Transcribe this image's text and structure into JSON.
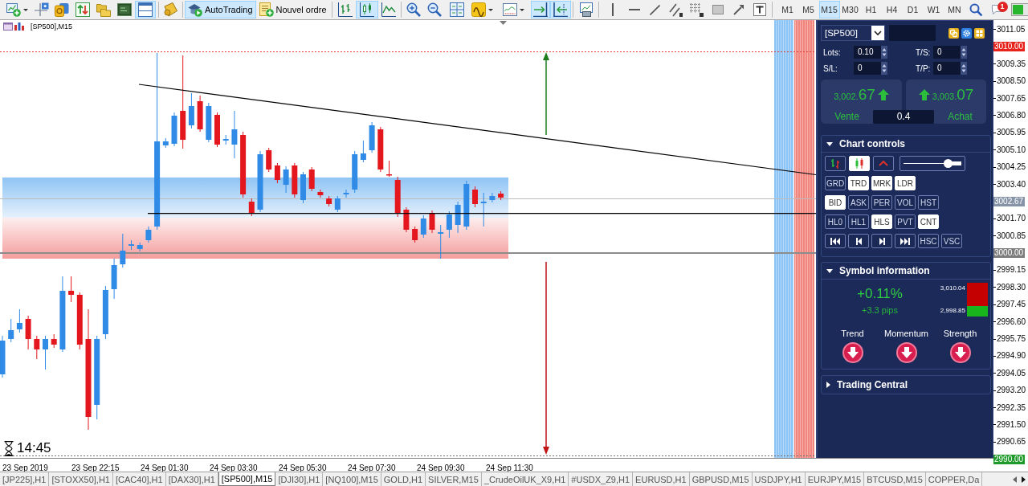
{
  "toolbar": {
    "buttons": [
      {
        "kind": "newchart",
        "pressed": false
      },
      {
        "kind": "crosshair",
        "pressed": false
      },
      {
        "kind": "coins",
        "pressed": false
      },
      {
        "kind": "navigator",
        "pressed": false
      },
      {
        "kind": "folders",
        "pressed": false
      },
      {
        "kind": "monitor",
        "pressed": false
      },
      {
        "kind": "panes",
        "pressed": true
      },
      {
        "kind": "separator"
      },
      {
        "kind": "scroll",
        "pressed": false
      },
      {
        "kind": "separator"
      },
      {
        "kind": "autotrading",
        "label": "AutoTrading",
        "pressed": true
      },
      {
        "kind": "neworder",
        "label": "Nouvel ordre",
        "pressed": false
      },
      {
        "kind": "separator"
      },
      {
        "kind": "barchart",
        "pressed": false
      },
      {
        "kind": "candles",
        "pressed": true
      },
      {
        "kind": "linechart",
        "pressed": false
      },
      {
        "kind": "separator"
      },
      {
        "kind": "zoomin",
        "pressed": false
      },
      {
        "kind": "zoomout",
        "pressed": false
      },
      {
        "kind": "tile",
        "pressed": false
      },
      {
        "kind": "indicators",
        "pressed": false
      },
      {
        "kind": "templates",
        "pressed": false
      },
      {
        "kind": "autoscroll",
        "pressed": true
      },
      {
        "kind": "shift",
        "pressed": true
      },
      {
        "kind": "separator"
      },
      {
        "kind": "properties",
        "pressed": false
      },
      {
        "kind": "separator"
      },
      {
        "kind": "vline",
        "pressed": false
      },
      {
        "kind": "hline",
        "pressed": false
      },
      {
        "kind": "trendline",
        "pressed": false
      },
      {
        "kind": "channel",
        "pressed": false
      },
      {
        "kind": "fibogrid",
        "pressed": false
      },
      {
        "kind": "rectangle",
        "pressed": false
      },
      {
        "kind": "arrow",
        "pressed": false
      },
      {
        "kind": "text",
        "pressed": false
      },
      {
        "kind": "separator"
      }
    ],
    "timeframes": [
      {
        "label": "M1",
        "selected": false
      },
      {
        "label": "M5",
        "selected": false
      },
      {
        "label": "M15",
        "selected": true
      },
      {
        "label": "M30",
        "selected": false
      },
      {
        "label": "H1",
        "selected": false
      },
      {
        "label": "H4",
        "selected": false
      },
      {
        "label": "D1",
        "selected": false
      },
      {
        "label": "W1",
        "selected": false
      },
      {
        "label": "MN",
        "selected": false
      }
    ],
    "status": [
      {
        "kind": "search"
      },
      {
        "kind": "chat",
        "badge": "1"
      },
      {
        "kind": "connection"
      }
    ]
  },
  "chart": {
    "title": "[SP500],M15",
    "timer": "14:45",
    "price_axis": [
      {
        "kind": "tick",
        "text": "3011.05"
      },
      {
        "kind": "tag",
        "text": "3010.00",
        "color": "#e8231b"
      },
      {
        "kind": "tick",
        "text": "3009.35"
      },
      {
        "kind": "tick",
        "text": "3008.50"
      },
      {
        "kind": "tick",
        "text": "3007.65"
      },
      {
        "kind": "tick",
        "text": "3006.80"
      },
      {
        "kind": "tick",
        "text": "3005.95"
      },
      {
        "kind": "tick",
        "text": "3005.10"
      },
      {
        "kind": "tick",
        "text": "3004.25"
      },
      {
        "kind": "tick",
        "text": "3003.40"
      },
      {
        "kind": "tag",
        "text": "3002.67",
        "color": "#8793a6"
      },
      {
        "kind": "tick",
        "text": "3001.70"
      },
      {
        "kind": "tick",
        "text": "3000.85"
      },
      {
        "kind": "tag",
        "text": "3000.00",
        "color": "#7d7d7d"
      },
      {
        "kind": "tick",
        "text": "2999.15"
      },
      {
        "kind": "tick",
        "text": "2998.30"
      },
      {
        "kind": "tick",
        "text": "2997.45"
      },
      {
        "kind": "tick",
        "text": "2996.60"
      },
      {
        "kind": "tick",
        "text": "2995.75"
      },
      {
        "kind": "tick",
        "text": "2994.90"
      },
      {
        "kind": "tick",
        "text": "2994.05"
      },
      {
        "kind": "tick",
        "text": "2993.20"
      },
      {
        "kind": "tick",
        "text": "2992.35"
      },
      {
        "kind": "tick",
        "text": "2991.50"
      },
      {
        "kind": "tick",
        "text": "2990.65"
      },
      {
        "kind": "tag",
        "text": "2990.00",
        "color": "#1f9a2b"
      }
    ],
    "time_axis": [
      "23 Sep 2019",
      "23 Sep 22:15",
      "24 Sep 01:30",
      "24 Sep 03:30",
      "24 Sep 05:30",
      "24 Sep 07:30",
      "24 Sep 09:30",
      "24 Sep 11:30"
    ]
  },
  "trade_panel": {
    "symbol": "[SP500]",
    "fields": [
      {
        "label": "Lots:",
        "value": "0.10"
      },
      {
        "label": "T/S:",
        "value": "0"
      },
      {
        "label": "S/L:",
        "value": "0"
      },
      {
        "label": "T/P:",
        "value": "0"
      }
    ],
    "sell": {
      "price_big_figure": "3,002.",
      "price_pips": "67",
      "rising": true,
      "label": "Vente"
    },
    "buy": {
      "price_big_figure": "3,003.",
      "price_pips": "07",
      "rising": true,
      "label": "Achat"
    },
    "spread": "0.4"
  },
  "chart_controls": {
    "title": "Chart controls",
    "expanded": true,
    "tools": [
      {
        "kind": "bars",
        "on": false
      },
      {
        "kind": "candles",
        "on": true
      },
      {
        "kind": "line",
        "on": false
      }
    ],
    "slider": {
      "level": 0.76
    },
    "buttons": [
      [
        {
          "label": "GRD",
          "on": false
        },
        {
          "label": "TRD",
          "on": true
        },
        {
          "label": "MRK",
          "on": true
        },
        {
          "label": "LDR",
          "on": true
        }
      ],
      [
        {
          "label": "BID",
          "on": true
        },
        {
          "label": "ASK",
          "on": false
        },
        {
          "label": "PER",
          "on": false
        },
        {
          "label": "VOL",
          "on": false
        },
        {
          "label": "HST",
          "on": false
        }
      ],
      [
        {
          "label": "HL0",
          "on": false
        },
        {
          "label": "HL1",
          "on": false
        },
        {
          "label": "HLS",
          "on": true
        },
        {
          "label": "PVT",
          "on": false
        },
        {
          "label": "CNT",
          "on": true
        }
      ]
    ],
    "navigation": [
      {
        "kind": "first"
      },
      {
        "kind": "previous"
      },
      {
        "kind": "next"
      },
      {
        "kind": "last"
      }
    ],
    "scale_buttons": [
      {
        "label": "HSC",
        "on": false
      },
      {
        "label": "VSC",
        "on": false
      }
    ]
  },
  "symbol_information": {
    "title": "Symbol information",
    "expanded": true,
    "change_percent": "+0.11%",
    "change_pips": "+3.3 pips",
    "range": {
      "high": "3,010.04",
      "low": "2,998.85",
      "level": 0.31
    },
    "indicators": [
      {
        "label": "Trend",
        "rising": false
      },
      {
        "label": "Momentum",
        "rising": false
      },
      {
        "label": "Strength",
        "rising": false
      }
    ]
  },
  "trading_central": {
    "title": "Trading Central",
    "expanded": false
  },
  "tabs": [
    {
      "label": "[JP225],H1",
      "selected": false
    },
    {
      "label": "[STOXX50],H1",
      "selected": false
    },
    {
      "label": "[CAC40],H1",
      "selected": false
    },
    {
      "label": "[DAX30],H1",
      "selected": false
    },
    {
      "label": "[SP500],M15",
      "selected": true
    },
    {
      "label": "[DJI30],H1",
      "selected": false
    },
    {
      "label": "[NQ100],M15",
      "selected": false
    },
    {
      "label": "GOLD,H1",
      "selected": false
    },
    {
      "label": "SILVER,M15",
      "selected": false
    },
    {
      "label": "_CrudeOilUK_X9,H1",
      "selected": false
    },
    {
      "label": "#USDX_Z9,H1",
      "selected": false
    },
    {
      "label": "EURUSD,H1",
      "selected": false
    },
    {
      "label": "GBPUSD,M15",
      "selected": false
    },
    {
      "label": "USDJPY,H1",
      "selected": false
    },
    {
      "label": "EURJPY,M15",
      "selected": false
    },
    {
      "label": "BTCUSD,M15",
      "selected": false
    },
    {
      "label": "COPPER,Da",
      "selected": false
    }
  ]
}
